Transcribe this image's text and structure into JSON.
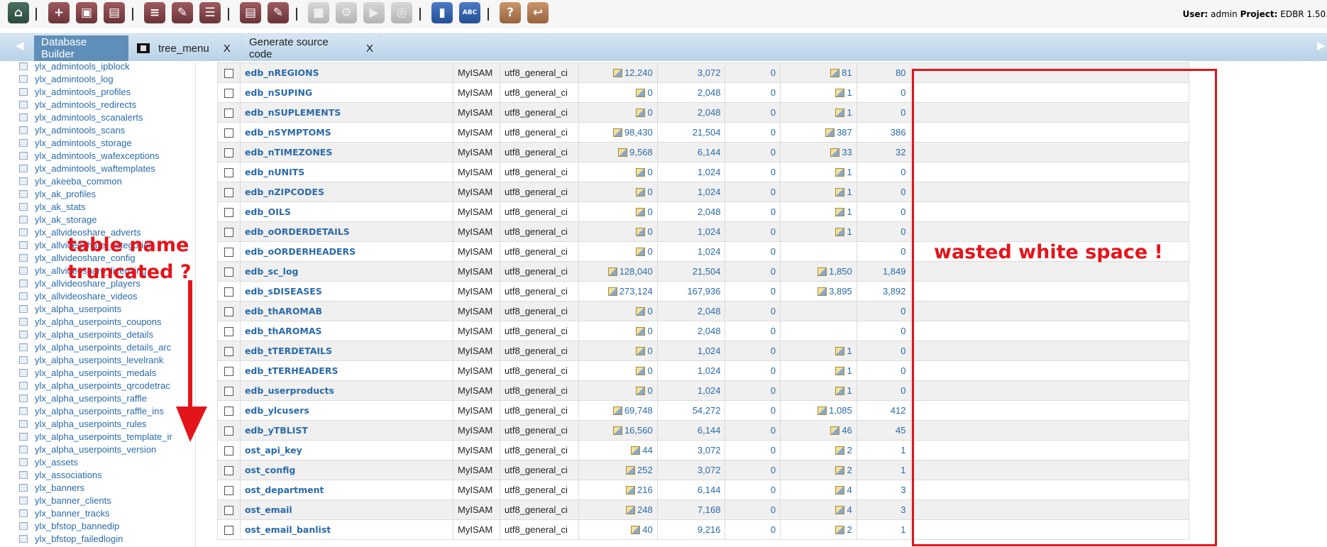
{
  "toolbar": {
    "buttons": [
      "home-icon",
      "add-icon",
      "open-box-icon",
      "archive-icon",
      "add-list-icon",
      "edit-list-icon",
      "list-icon",
      "document-icon",
      "document-edit-icon",
      "save-icon",
      "gear-icon",
      "play-icon",
      "globe-icon",
      "book-icon",
      "abc-icon",
      "help-icon",
      "exit-icon"
    ],
    "user_label": "User:",
    "user_value": "admin",
    "project_label": "Project:",
    "project_value": "EDBR 1.50."
  },
  "tabs": [
    {
      "label": "Database Builder",
      "active": true,
      "closable": false
    },
    {
      "label": "tree_menu",
      "active": false,
      "closable": true
    },
    {
      "label": "Generate source code",
      "active": false,
      "closable": true
    }
  ],
  "tab_close_label": "X",
  "sidebar": {
    "items": [
      "ylx_admintools_ipblock",
      "ylx_admintools_log",
      "ylx_admintools_profiles",
      "ylx_admintools_redirects",
      "ylx_admintools_scanalerts",
      "ylx_admintools_scans",
      "ylx_admintools_storage",
      "ylx_admintools_wafexceptions",
      "ylx_admintools_waftemplates",
      "ylx_akeeba_common",
      "ylx_ak_profiles",
      "ylx_ak_stats",
      "ylx_ak_storage",
      "ylx_allvideoshare_adverts",
      "ylx_allvideoshare_categories",
      "ylx_allvideoshare_config",
      "ylx_allvideoshare_licensing",
      "ylx_allvideoshare_players",
      "ylx_allvideoshare_videos",
      "ylx_alpha_userpoints",
      "ylx_alpha_userpoints_coupons",
      "ylx_alpha_userpoints_details",
      "ylx_alpha_userpoints_details_arc",
      "ylx_alpha_userpoints_levelrank",
      "ylx_alpha_userpoints_medals",
      "ylx_alpha_userpoints_qrcodetrac",
      "ylx_alpha_userpoints_raffle",
      "ylx_alpha_userpoints_raffle_ins",
      "ylx_alpha_userpoints_rules",
      "ylx_alpha_userpoints_template_ir",
      "ylx_alpha_userpoints_version",
      "ylx_assets",
      "ylx_associations",
      "ylx_banners",
      "ylx_banner_clients",
      "ylx_banner_tracks",
      "ylx_bfstop_bannedip",
      "ylx_bfstop_failedlogin"
    ]
  },
  "table": {
    "rows": [
      {
        "name": "edb_nREGIONS",
        "engine": "MyISAM",
        "collation": "utf8_general_ci",
        "rows": "12,240",
        "size": "3,072",
        "overhead": "0",
        "index": "81",
        "auto": "80"
      },
      {
        "name": "edb_nSUPING",
        "engine": "MyISAM",
        "collation": "utf8_general_ci",
        "rows": "0",
        "size": "2,048",
        "overhead": "0",
        "index": "1",
        "auto": "0"
      },
      {
        "name": "edb_nSUPLEMENTS",
        "engine": "MyISAM",
        "collation": "utf8_general_ci",
        "rows": "0",
        "size": "2,048",
        "overhead": "0",
        "index": "1",
        "auto": "0"
      },
      {
        "name": "edb_nSYMPTOMS",
        "engine": "MyISAM",
        "collation": "utf8_general_ci",
        "rows": "98,430",
        "size": "21,504",
        "overhead": "0",
        "index": "387",
        "auto": "386"
      },
      {
        "name": "edb_nTIMEZONES",
        "engine": "MyISAM",
        "collation": "utf8_general_ci",
        "rows": "9,568",
        "size": "6,144",
        "overhead": "0",
        "index": "33",
        "auto": "32"
      },
      {
        "name": "edb_nUNITS",
        "engine": "MyISAM",
        "collation": "utf8_general_ci",
        "rows": "0",
        "size": "1,024",
        "overhead": "0",
        "index": "1",
        "auto": "0"
      },
      {
        "name": "edb_nZIPCODES",
        "engine": "MyISAM",
        "collation": "utf8_general_ci",
        "rows": "0",
        "size": "1,024",
        "overhead": "0",
        "index": "1",
        "auto": "0"
      },
      {
        "name": "edb_OILS",
        "engine": "MyISAM",
        "collation": "utf8_general_ci",
        "rows": "0",
        "size": "2,048",
        "overhead": "0",
        "index": "1",
        "auto": "0"
      },
      {
        "name": "edb_oORDERDETAILS",
        "engine": "MyISAM",
        "collation": "utf8_general_ci",
        "rows": "0",
        "size": "1,024",
        "overhead": "0",
        "index": "1",
        "auto": "0"
      },
      {
        "name": "edb_oORDERHEADERS",
        "engine": "MyISAM",
        "collation": "utf8_general_ci",
        "rows": "0",
        "size": "1,024",
        "overhead": "0",
        "index": "",
        "auto": "0"
      },
      {
        "name": "edb_sc_log",
        "engine": "MyISAM",
        "collation": "utf8_general_ci",
        "rows": "128,040",
        "size": "21,504",
        "overhead": "0",
        "index": "1,850",
        "auto": "1,849"
      },
      {
        "name": "edb_sDISEASES",
        "engine": "MyISAM",
        "collation": "utf8_general_ci",
        "rows": "273,124",
        "size": "167,936",
        "overhead": "0",
        "index": "3,895",
        "auto": "3,892"
      },
      {
        "name": "edb_thAROMAB",
        "engine": "MyISAM",
        "collation": "utf8_general_ci",
        "rows": "0",
        "size": "2,048",
        "overhead": "0",
        "index": "",
        "auto": "0"
      },
      {
        "name": "edb_thAROMAS",
        "engine": "MyISAM",
        "collation": "utf8_general_ci",
        "rows": "0",
        "size": "2,048",
        "overhead": "0",
        "index": "",
        "auto": "0"
      },
      {
        "name": "edb_tTERDETAILS",
        "engine": "MyISAM",
        "collation": "utf8_general_ci",
        "rows": "0",
        "size": "1,024",
        "overhead": "0",
        "index": "1",
        "auto": "0"
      },
      {
        "name": "edb_tTERHEADERS",
        "engine": "MyISAM",
        "collation": "utf8_general_ci",
        "rows": "0",
        "size": "1,024",
        "overhead": "0",
        "index": "1",
        "auto": "0"
      },
      {
        "name": "edb_userproducts",
        "engine": "MyISAM",
        "collation": "utf8_general_ci",
        "rows": "0",
        "size": "1,024",
        "overhead": "0",
        "index": "1",
        "auto": "0"
      },
      {
        "name": "edb_ylcusers",
        "engine": "MyISAM",
        "collation": "utf8_general_ci",
        "rows": "69,748",
        "size": "54,272",
        "overhead": "0",
        "index": "1,085",
        "auto": "412"
      },
      {
        "name": "edb_yTBLIST",
        "engine": "MyISAM",
        "collation": "utf8_general_ci",
        "rows": "16,560",
        "size": "6,144",
        "overhead": "0",
        "index": "46",
        "auto": "45"
      },
      {
        "name": "ost_api_key",
        "engine": "MyISAM",
        "collation": "utf8_general_ci",
        "rows": "44",
        "size": "3,072",
        "overhead": "0",
        "index": "2",
        "auto": "1"
      },
      {
        "name": "ost_config",
        "engine": "MyISAM",
        "collation": "utf8_general_ci",
        "rows": "252",
        "size": "3,072",
        "overhead": "0",
        "index": "2",
        "auto": "1"
      },
      {
        "name": "ost_department",
        "engine": "MyISAM",
        "collation": "utf8_general_ci",
        "rows": "216",
        "size": "6,144",
        "overhead": "0",
        "index": "4",
        "auto": "3"
      },
      {
        "name": "ost_email",
        "engine": "MyISAM",
        "collation": "utf8_general_ci",
        "rows": "248",
        "size": "7,168",
        "overhead": "0",
        "index": "4",
        "auto": "3"
      },
      {
        "name": "ost_email_banlist",
        "engine": "MyISAM",
        "collation": "utf8_general_ci",
        "rows": "40",
        "size": "9,216",
        "overhead": "0",
        "index": "2",
        "auto": "1"
      }
    ]
  },
  "annotations": {
    "wasted": "wasted white space !",
    "truncated_line1": "table name",
    "truncated_line2": "truncated ?",
    "color": "#e4141b"
  }
}
